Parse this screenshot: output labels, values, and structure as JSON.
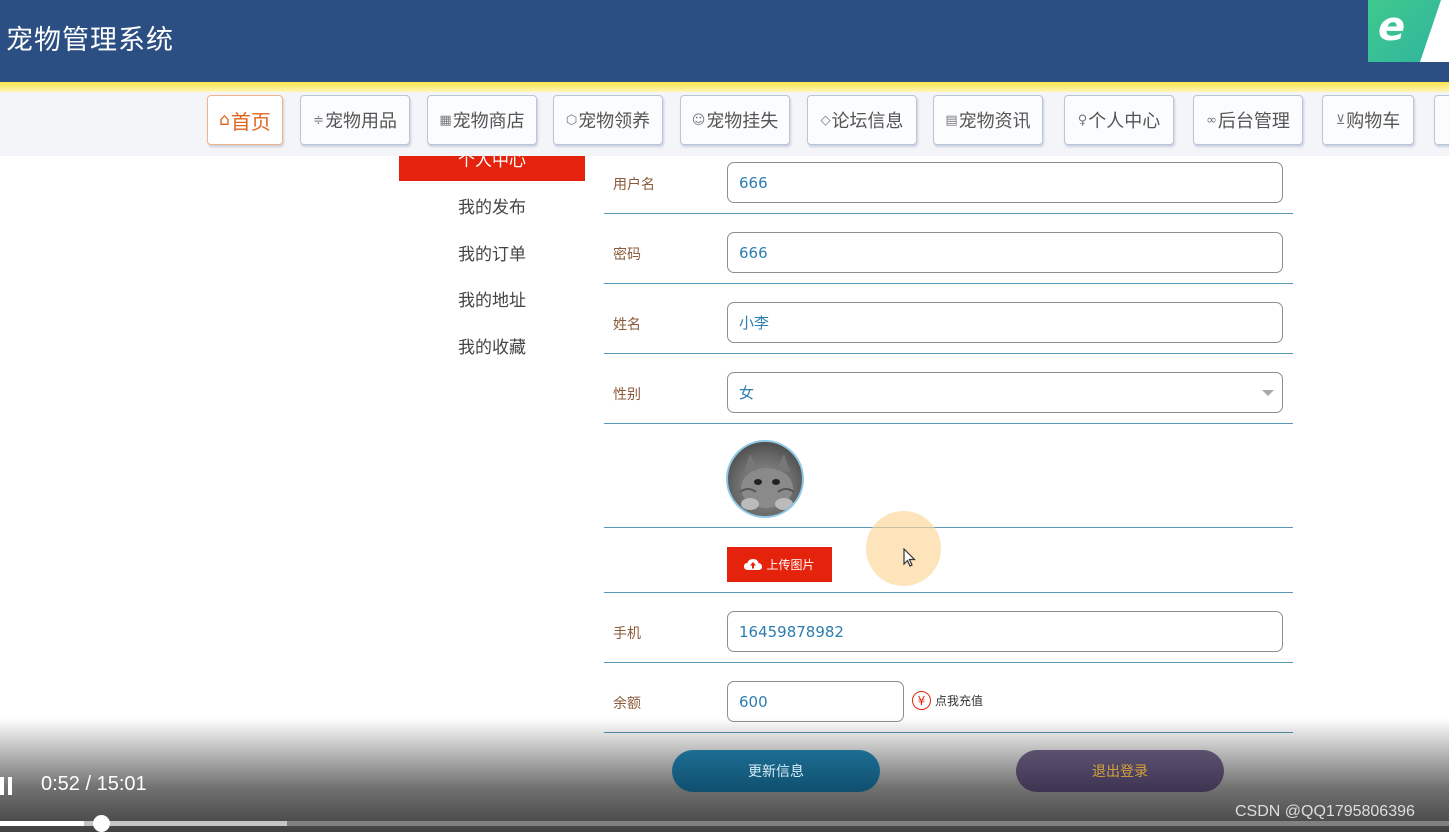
{
  "header": {
    "title": "宠物管理系统"
  },
  "browser_logo": {
    "glyph": "e"
  },
  "nav": {
    "items": [
      {
        "label": "首页",
        "icon": "home-icon",
        "glyph": "⌂",
        "active": true
      },
      {
        "label": "宠物用品",
        "icon": "sliders-icon",
        "glyph": "≑",
        "active": false
      },
      {
        "label": "宠物商店",
        "icon": "calendar-icon",
        "glyph": "▦",
        "active": false
      },
      {
        "label": "宠物领养",
        "icon": "box-icon",
        "glyph": "⬡",
        "active": false
      },
      {
        "label": "宠物挂失",
        "icon": "face-icon",
        "glyph": "☺",
        "active": false
      },
      {
        "label": "论坛信息",
        "icon": "tag-icon",
        "glyph": "◇",
        "active": false
      },
      {
        "label": "宠物资讯",
        "icon": "clipboard-icon",
        "glyph": "▤",
        "active": false
      },
      {
        "label": "个人中心",
        "icon": "user-icon",
        "glyph": "♀",
        "active": false
      },
      {
        "label": "后台管理",
        "icon": "link-icon",
        "glyph": "∞",
        "active": false
      },
      {
        "label": "购物车",
        "icon": "cart-icon",
        "glyph": "⊻",
        "active": false
      }
    ]
  },
  "sidebar": {
    "active_label": "个人中心",
    "items": [
      "我的发布",
      "我的订单",
      "我的地址",
      "我的收藏"
    ]
  },
  "form": {
    "username": {
      "label": "用户名",
      "value": "666"
    },
    "password": {
      "label": "密码",
      "value": "666"
    },
    "name": {
      "label": "姓名",
      "value": "小李"
    },
    "gender": {
      "label": "性别",
      "value": "女"
    },
    "upload_label": "上传图片",
    "phone": {
      "label": "手机",
      "value": "16459878982"
    },
    "balance": {
      "label": "余额",
      "value": "600"
    },
    "recharge_symbol": "¥",
    "recharge_label": "点我充值",
    "update_button": "更新信息",
    "logout_button": "退出登录"
  },
  "player": {
    "time": "0:52 / 15:01",
    "played_fraction": 0.058,
    "buffered_fraction": 0.198
  },
  "watermark": "CSDN @QQ1795806396",
  "colors": {
    "header": "#2b4f82",
    "accent": "#e5230d",
    "nav_active": "#e0651f",
    "field_text": "#2c7db0"
  }
}
